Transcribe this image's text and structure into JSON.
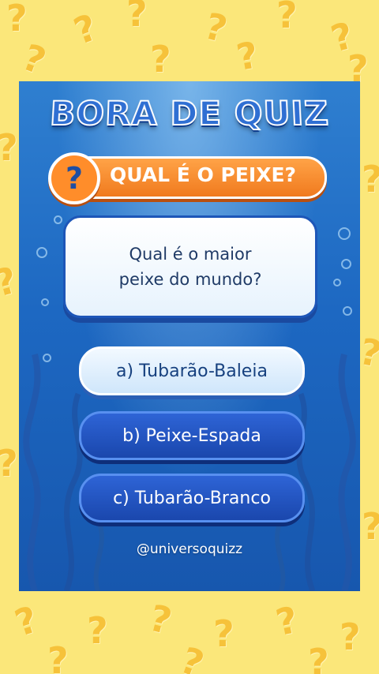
{
  "title": "BORA DE QUIZ",
  "category": {
    "icon": "question-mark-icon",
    "icon_glyph": "?",
    "label": "QUAL É O PEIXE?"
  },
  "question": "Qual é o maior peixe do mundo?",
  "options": [
    {
      "label": "a) Tubarão-Baleia"
    },
    {
      "label": "b) Peixe-Espada"
    },
    {
      "label": "c) Tubarão-Branco"
    }
  ],
  "handle": "@universoquizz",
  "colors": {
    "background": "#fbe77a",
    "card": "#1d68c2",
    "accent": "#f07a1e",
    "option_selected": "#cfe6fb",
    "option": "#1a47ad"
  }
}
